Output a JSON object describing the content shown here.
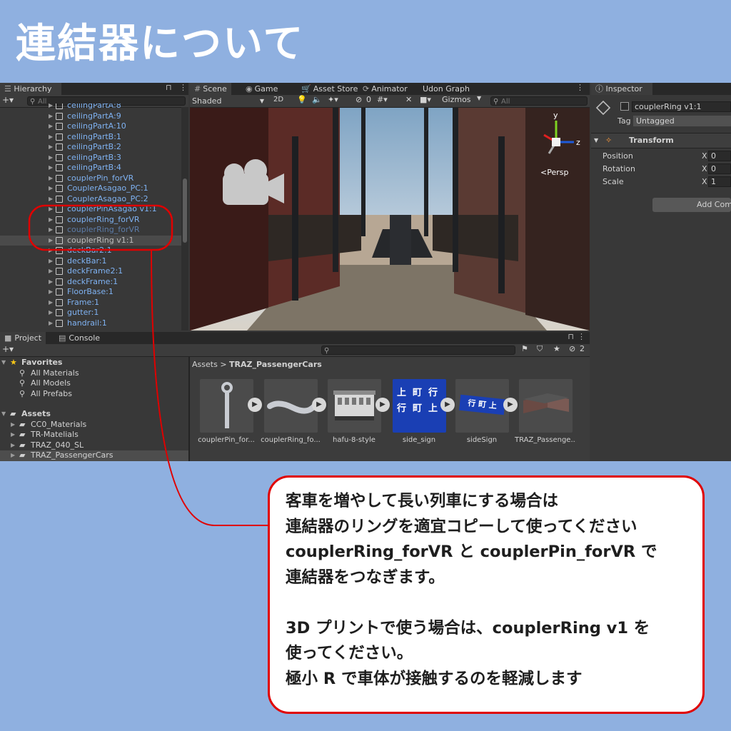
{
  "title": "連結器について",
  "hierarchy": {
    "tab": "Hierarchy",
    "add": "+▾",
    "search_placeholder": "All",
    "items": [
      {
        "label": "ceilingPartA:8",
        "state": "normal"
      },
      {
        "label": "ceilingPartA:9",
        "state": "normal"
      },
      {
        "label": "ceilingPartA:10",
        "state": "normal"
      },
      {
        "label": "cellingPartB:1",
        "state": "normal"
      },
      {
        "label": "ceilingPartB:2",
        "state": "normal"
      },
      {
        "label": "ceilingPartB:3",
        "state": "normal"
      },
      {
        "label": "ceilingPartB:4",
        "state": "normal"
      },
      {
        "label": "couplerPin_forVR",
        "state": "normal"
      },
      {
        "label": "CouplerAsagao_PC:1",
        "state": "normal"
      },
      {
        "label": "CouplerAsagao_PC:2",
        "state": "normal"
      },
      {
        "label": "couplerPinAsagao v1:1",
        "state": "normal"
      },
      {
        "label": "couplerRing_forVR",
        "state": "normal"
      },
      {
        "label": "couplerRing_forVR",
        "state": "dim"
      },
      {
        "label": "couplerRing v1:1",
        "state": "selected"
      },
      {
        "label": "deckBar2:1",
        "state": "normal"
      },
      {
        "label": "deckBar:1",
        "state": "normal"
      },
      {
        "label": "deckFrame2:1",
        "state": "normal"
      },
      {
        "label": "deckFrame:1",
        "state": "normal"
      },
      {
        "label": "FloorBase:1",
        "state": "normal"
      },
      {
        "label": "Frame:1",
        "state": "normal"
      },
      {
        "label": "gutter:1",
        "state": "normal"
      },
      {
        "label": "handrail:1",
        "state": "normal"
      }
    ]
  },
  "scene": {
    "tabs": [
      "Scene",
      "Game",
      "Asset Store",
      "Animator",
      "Udon Graph"
    ],
    "shading": "Shaded",
    "mode_2d": "2D",
    "hidden_count": "0",
    "gizmos": "Gizmos",
    "search_placeholder": "All",
    "persp": "<Persp",
    "axis_y": "y",
    "axis_z": "z"
  },
  "inspector": {
    "tab": "Inspector",
    "object_name": "couplerRing v1:1",
    "tag_label": "Tag",
    "tag_value": "Untagged",
    "component": "Transform",
    "rows": [
      {
        "label": "Position",
        "axis": "X",
        "value": "0"
      },
      {
        "label": "Rotation",
        "axis": "X",
        "value": "0"
      },
      {
        "label": "Scale",
        "axis": "X",
        "value": "1"
      }
    ],
    "add_component": "Add Com"
  },
  "project": {
    "tabs": [
      "Project",
      "Console"
    ],
    "add": "+▾",
    "hidden_count": "2",
    "tree": {
      "favorites": "Favorites",
      "favorite_items": [
        "All Materials",
        "All Models",
        "All Prefabs"
      ],
      "assets": "Assets",
      "folders": [
        "CC0_Materials",
        "TR-Matelials",
        "TRAZ_040_SL",
        "TRAZ_PassengerCars"
      ]
    },
    "breadcrumb": {
      "root": "Assets",
      "sep": ">",
      "current": "TRAZ_PassengerCars"
    },
    "assets": [
      {
        "label": "couplerPin_for..."
      },
      {
        "label": "couplerRing_fo..."
      },
      {
        "label": "hafu-8-style"
      },
      {
        "label": "side_sign"
      },
      {
        "label": "sideSign"
      },
      {
        "label": "TRAZ_Passenge..."
      }
    ],
    "sign_text": {
      "top_left": "上",
      "top_mid": "町",
      "top_right": "行",
      "bottom_left": "行",
      "bottom_mid": "町",
      "bottom_right": "上"
    },
    "side_sign_text": "行 町 上"
  },
  "annotation": {
    "lines": [
      "客車を増やして長い列車にする場合は",
      "連結器のリングを適宜コピーして使ってください",
      "couplerRing_forVR と couplerPin_forVR で",
      "連結器をつなぎます。",
      "",
      "3D プリントで使う場合は、couplerRing v1 を",
      "使ってください。",
      "極小 R で車体が接触するのを軽減します"
    ]
  },
  "colors": {
    "background": "#8fb0e0",
    "highlight": "#e00000",
    "hierarchy_text": "#7fb2f2"
  }
}
